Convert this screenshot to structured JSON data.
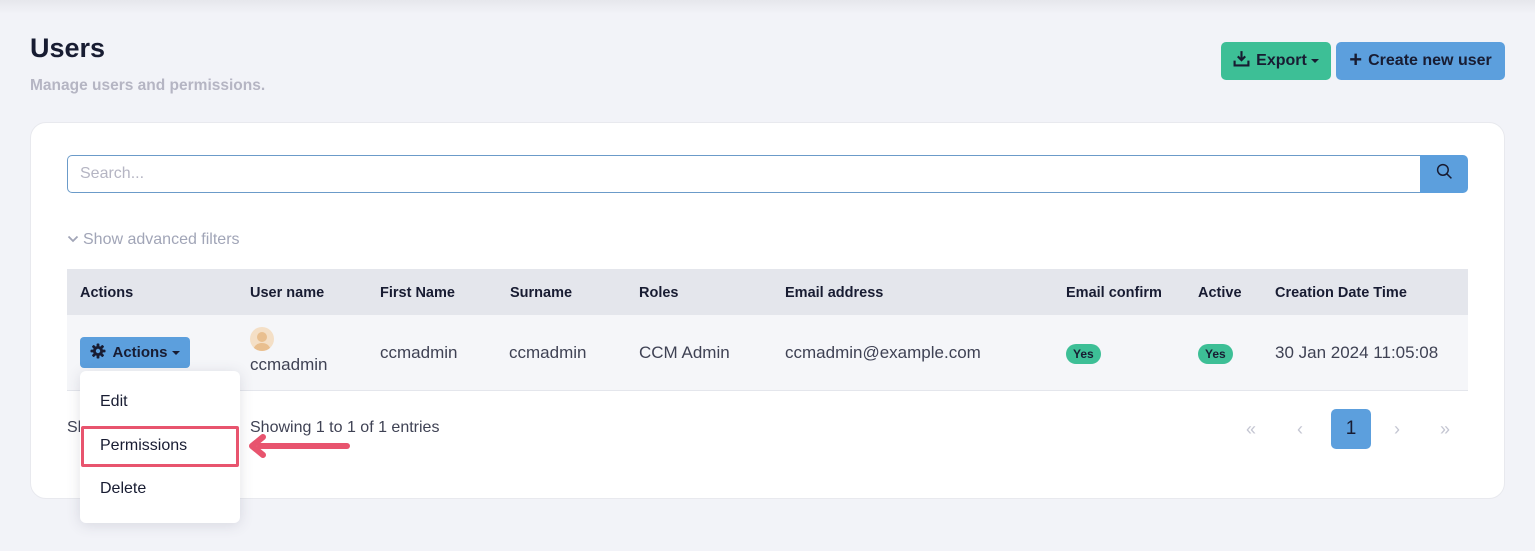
{
  "header": {
    "title": "Users",
    "subtitle": "Manage users and permissions.",
    "export_label": "Export",
    "create_label": "Create new user"
  },
  "search": {
    "placeholder": "Search...",
    "value": ""
  },
  "filters": {
    "toggle_label": "Show advanced filters"
  },
  "table": {
    "columns": [
      "Actions",
      "User name",
      "First Name",
      "Surname",
      "Roles",
      "Email address",
      "Email confirm",
      "Active",
      "Creation Date Time"
    ],
    "rows": [
      {
        "actions_label": "Actions",
        "username": "ccmadmin",
        "first_name": "ccmadmin",
        "surname": "ccmadmin",
        "roles": "CCM Admin",
        "email": "ccmadmin@example.com",
        "email_confirm": "Yes",
        "active": "Yes",
        "created": "30 Jan 2024 11:05:08"
      }
    ]
  },
  "dropdown": {
    "items": [
      "Edit",
      "Permissions",
      "Delete"
    ],
    "highlighted": "Permissions"
  },
  "footer": {
    "info_partial": "Sh",
    "info": "Showing 1 to 1 of 1 entries"
  },
  "pagination": {
    "first": "«",
    "prev": "‹",
    "current": "1",
    "next": "›",
    "last": "»"
  },
  "colors": {
    "green": "#3dbf96",
    "blue": "#5c9fdd",
    "highlight": "#e8546e"
  }
}
